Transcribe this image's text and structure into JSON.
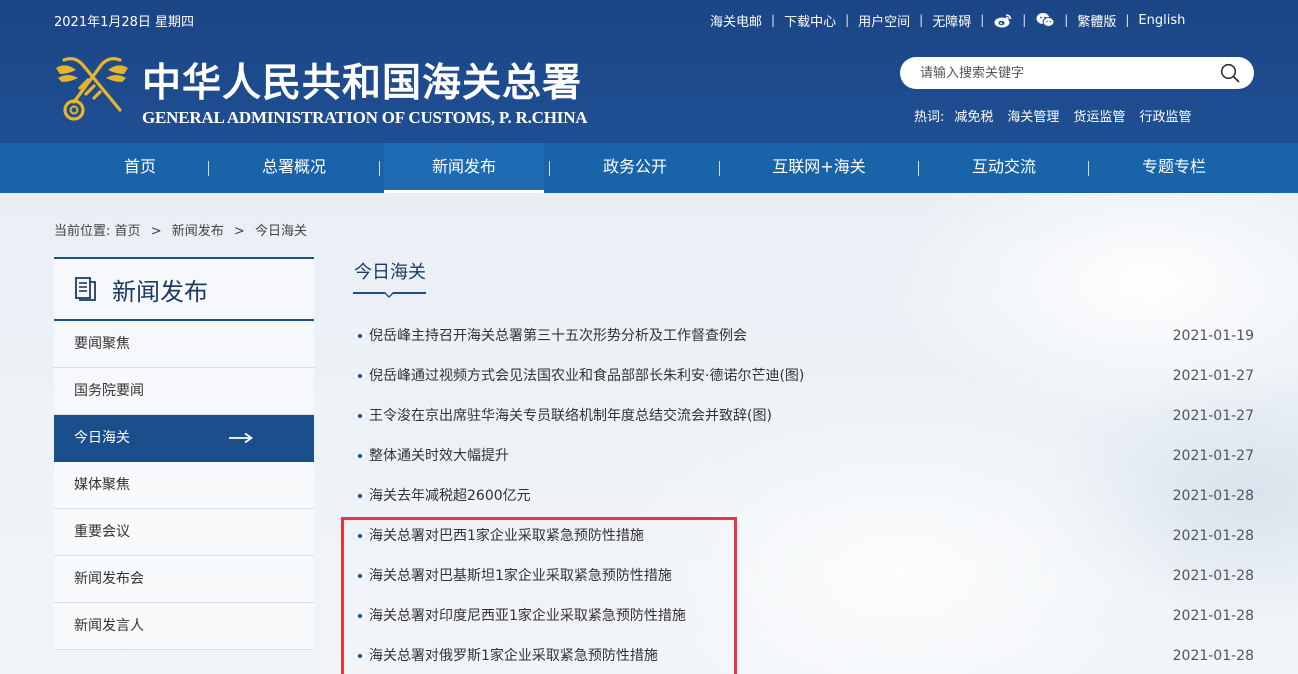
{
  "header": {
    "date": "2021年1月28日 星期四",
    "top_links": [
      "海关电邮",
      "下载中心",
      "用户空间",
      "无障碍"
    ],
    "lang_traditional": "繁體版",
    "lang_english": "English",
    "title_cn": "中华人民共和国海关总署",
    "title_en": "GENERAL ADMINISTRATION OF CUSTOMS, P. R.CHINA",
    "search_placeholder": "请输入搜索关键字",
    "hot_label": "热词:",
    "hot_words": [
      "减免税",
      "海关管理",
      "货运监管",
      "行政监管"
    ]
  },
  "nav": {
    "items": [
      "首页",
      "总署概况",
      "新闻发布",
      "政务公开",
      "互联网+海关",
      "互动交流",
      "专题专栏"
    ],
    "active_index": 2
  },
  "breadcrumb": {
    "label": "当前位置:",
    "items": [
      "首页",
      "新闻发布",
      "今日海关"
    ],
    "separator": ">"
  },
  "sidebar": {
    "title": "新闻发布",
    "items": [
      "要闻聚焦",
      "国务院要闻",
      "今日海关",
      "媒体聚焦",
      "重要会议",
      "新闻发布会",
      "新闻发言人"
    ],
    "active_index": 2
  },
  "content": {
    "section_title": "今日海关",
    "news": [
      {
        "title": "倪岳峰主持召开海关总署第三十五次形势分析及工作督查例会",
        "date": "2021-01-19"
      },
      {
        "title": "倪岳峰通过视频方式会见法国农业和食品部部长朱利安·德诺尔芒迪(图)",
        "date": "2021-01-27"
      },
      {
        "title": "王令浚在京出席驻华海关专员联络机制年度总结交流会并致辞(图)",
        "date": "2021-01-27"
      },
      {
        "title": "整体通关时效大幅提升",
        "date": "2021-01-27"
      },
      {
        "title": "海关去年减税超2600亿元",
        "date": "2021-01-28"
      },
      {
        "title": "海关总署对巴西1家企业采取紧急预防性措施",
        "date": "2021-01-28"
      },
      {
        "title": "海关总署对巴基斯坦1家企业采取紧急预防性措施",
        "date": "2021-01-28"
      },
      {
        "title": "海关总署对印度尼西亚1家企业采取紧急预防性措施",
        "date": "2021-01-28"
      },
      {
        "title": "海关总署对俄罗斯1家企业采取紧急预防性措施",
        "date": "2021-01-28"
      }
    ]
  },
  "colors": {
    "header_bg": "#1e4b8e",
    "nav_bg": "#1963a8",
    "sidebar_active": "#1b4f8c",
    "highlight": "#e8343a",
    "emblem_gold": "#e8b52a"
  }
}
